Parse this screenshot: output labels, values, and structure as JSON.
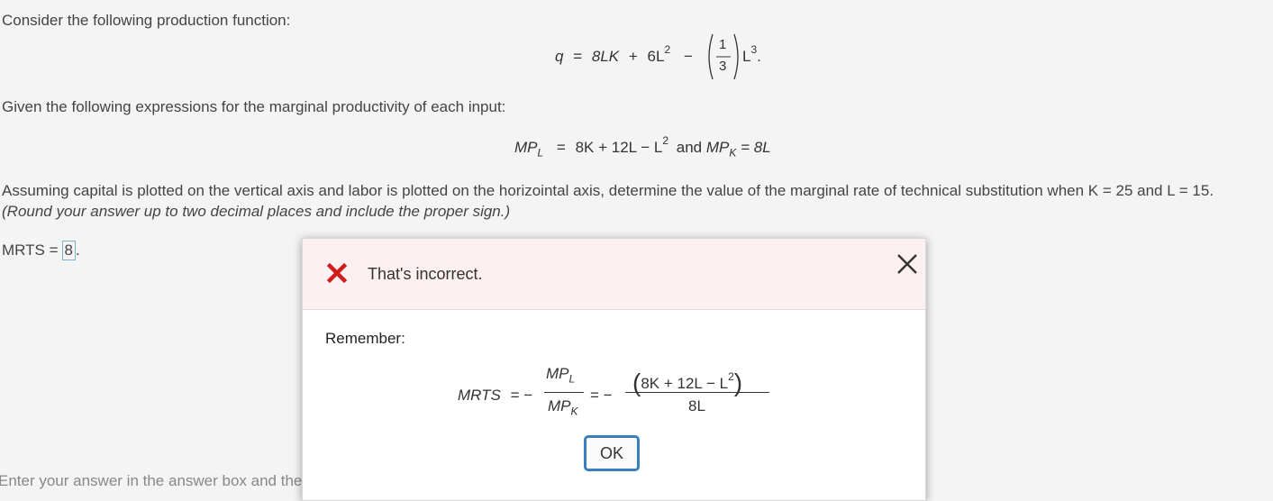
{
  "question": {
    "intro": "Consider the following production function:",
    "production_function": {
      "q": "q",
      "eq": "=",
      "term1": "8LK",
      "plus": "+",
      "term2": "6L",
      "exp2": "2",
      "minus": "−",
      "frac_num": "1",
      "frac_den": "3",
      "term3": "L",
      "exp3": "3",
      "period": "."
    },
    "given": "Given the following expressions for the marginal productivity of each input:",
    "mp_expr": {
      "mpl": "MP",
      "mpl_sub": "L",
      "eq": "=",
      "rhs": "8K + 12L − L",
      "rhs_exp": "2",
      "and": "and",
      "mpk": "MP",
      "mpk_sub": "K",
      "mpk_rhs": "= 8L"
    },
    "assume": "Assuming capital is plotted on the vertical axis and labor is plotted on the horizointal axis, determine the value of the marginal rate of technical substitution when K = 25 and L = 15.",
    "round_note": "(Round your answer up to two decimal places and include the proper sign.)",
    "mrts_label": "MRTS =",
    "answer_value": "8",
    "answer_period": ".",
    "footer_note": "Enter your answer in the answer box and then click Check Answer."
  },
  "modal": {
    "title": "That's incorrect.",
    "remember": "Remember:",
    "formula": {
      "lhs": "MRTS",
      "eq1": "= −",
      "num_mp": "MP",
      "num_sub": "L",
      "den_mp": "MP",
      "den_sub": "K",
      "eq2": "= −",
      "rhs_num": "8K + 12L − L",
      "rhs_num_exp": "2",
      "rhs_den": "8L"
    },
    "ok_label": "OK",
    "colors": {
      "error_red": "#d01c1c",
      "ok_border": "#3a7fc0",
      "header_bg": "#fdf0f0"
    }
  }
}
